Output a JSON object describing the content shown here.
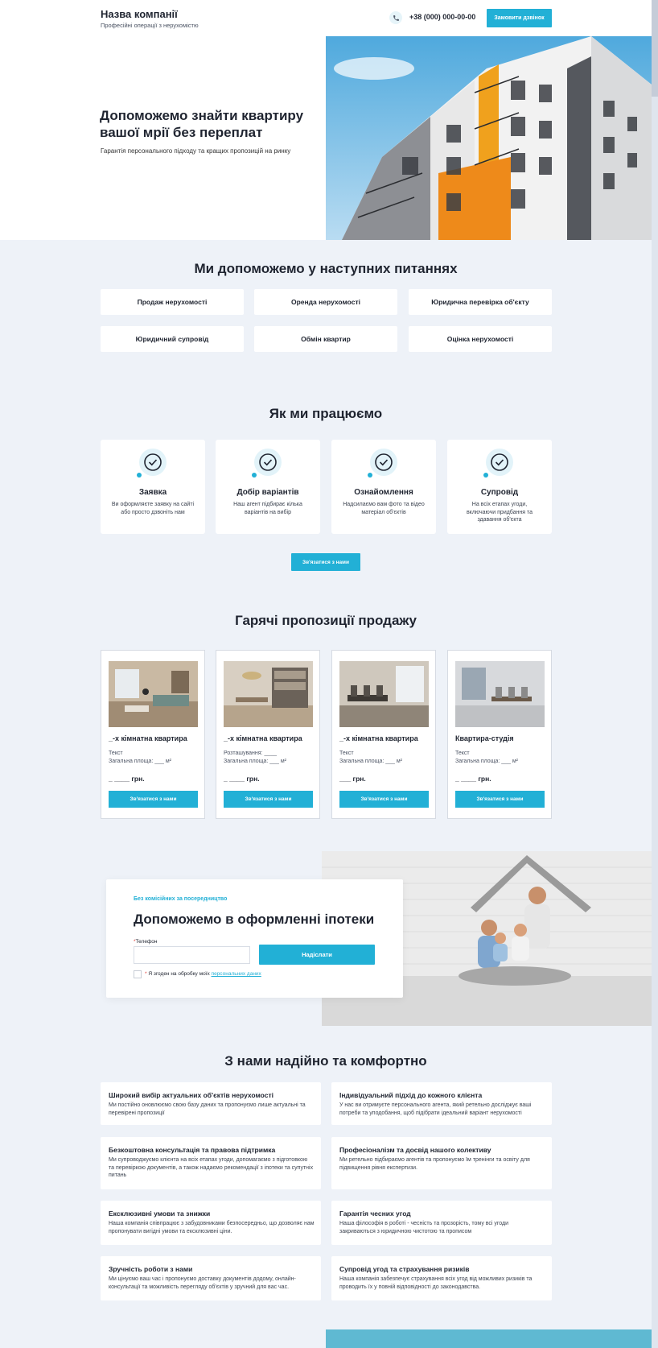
{
  "header": {
    "company_name": "Назва компанії",
    "tagline": "Професійні операції з нерухомістю",
    "phone_icon": "phone-icon",
    "phone": "+38 (000) 000-00-00",
    "call_button": "Замовити дзвінок"
  },
  "hero": {
    "title": "Допоможемо знайти квартиру вашої мрії без переплат",
    "subtitle": "Гарантія персонального підходу та кращих пропозицій на ринку"
  },
  "services": {
    "title": "Ми допоможемо у наступних питаннях",
    "items": [
      "Продаж нерухомості",
      "Оренда нерухомості",
      "Юридична перевірка об'єкту",
      "Юридичний супровід",
      "Обмін квартир",
      "Оцінка нерухомості"
    ]
  },
  "how": {
    "title": "Як ми працюємо",
    "steps": [
      {
        "title": "Заявка",
        "text": "Ви оформляєте заявку на сайті або просто дзвоніть нам"
      },
      {
        "title": "Добір варіантів",
        "text": "Наш агент підбирає кілька варіантів на вибір"
      },
      {
        "title": "Ознайомлення",
        "text": "Надсилаємо вам фото та відео матеріал об'єктів"
      },
      {
        "title": "Супровід",
        "text": "На всіх етапах угоди, включаючи придбання та здавання об'єкта"
      }
    ],
    "step_icon": "check-circle-icon",
    "button": "Зв'язатися з нами"
  },
  "offers": {
    "title": "Гарячі пропозиції продажу",
    "items": [
      {
        "title": "_-х кімнатна квартира",
        "line1": "Текст",
        "line2": "Загальна площа: ___ м²",
        "price": "_ ____ грн.",
        "button": "Зв'язатися з нами"
      },
      {
        "title": "_-х кімнатна квартира",
        "line1": "Розташування: ____",
        "line2": "Загальна площа: ___ м²",
        "price": "_ ____ грн.",
        "button": "Зв'язатися з нами"
      },
      {
        "title": "_-х кімнатна квартира",
        "line1": "Текст",
        "line2": "Загальна площа: ___ м²",
        "price": "___ грн.",
        "button": "Зв'язатися з нами"
      },
      {
        "title": "Квартира-студія",
        "line1": "Текст",
        "line2": "Загальна площа: ___ м²",
        "price": "_ ____ грн.",
        "button": "Зв'язатися з нами"
      }
    ]
  },
  "mortgage": {
    "kicker": "Без комісійних за посередництво",
    "title": "Допоможемо в оформленні іпотеки",
    "phone_label": "Телефон",
    "required_mark": "*",
    "phone_value": "",
    "submit": "Надіслати",
    "consent_text": "Я згоден на обробку моїх",
    "consent_link": "персональних даних"
  },
  "features": {
    "title": "З нами надійно та комфортно",
    "items": [
      {
        "title": "Широкий вибір актуальних об'єктів нерухомості",
        "text": "Ми постійно оновлюємо свою базу даних та пропонуємо лише актуальні та перевірені пропозиції"
      },
      {
        "title": "Індивідуальний підхід до кожного клієнта",
        "text": "У нас ви отримуєте персонального агента, який ретельно досліджує ваші потреби та уподобання, щоб підібрати ідеальний варіант нерухомості"
      },
      {
        "title": "Безкоштовна консультація та правова підтримка",
        "text": "Ми супроводжуємо клієнта на всіх етапах угоди, допомагаємо з підготовкою та перевіркою документів, а також надаємо рекомендації з іпотеки та супутніх питань"
      },
      {
        "title": "Професіоналізм та досвід нашого колективу",
        "text": "Ми ретельно підбираємо агентів та пропонуємо їм тренінги та освіту для підвищення рівня експертизи."
      },
      {
        "title": "Ексклюзивні умови та знижки",
        "text": "Наша компанія співпрацює з забудовниками безпосередньо, що дозволяє нам пропонувати вигідні умови та ексклюзивні ціни."
      },
      {
        "title": "Гарантія чесних угод",
        "text": "Наша філософія в роботі - чесність та прозорість, тому всі угоди закриваються з юридичною чистотою та прописом"
      },
      {
        "title": "Зручність роботи з нами",
        "text": "Ми цінуємо ваш час і пропонуємо доставку документів додому, онлайн-консультації та можливість перегляду об'єктів у зручний для вас час."
      },
      {
        "title": "Супровід угод та страхування ризиків",
        "text": "Наша компанія забезпечує страхування всіх угод від можливих ризиків та проводить їх у повній відповідності до законодавства."
      }
    ]
  },
  "colors": {
    "accent": "#22b0d6",
    "background": "#eef2f8",
    "text": "#1f2430"
  }
}
